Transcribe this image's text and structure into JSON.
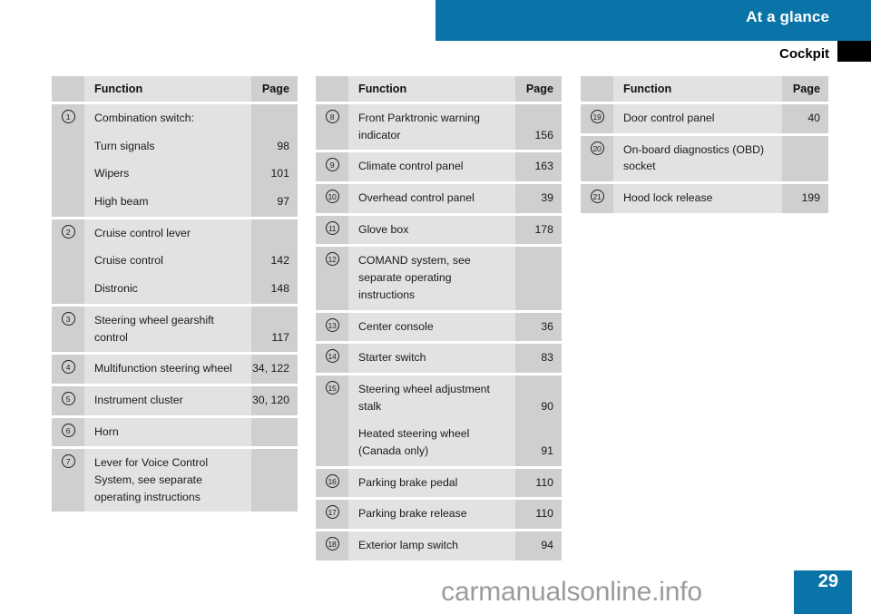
{
  "header": {
    "title": "At a glance",
    "section": "Cockpit"
  },
  "footer": {
    "watermark": "carmanualsonline.info",
    "page_number": "29"
  },
  "colors": {
    "accent_blue": "#0a74a8",
    "tab_black": "#000000",
    "cell_dark": "#cfcfcf",
    "cell_light": "#e2e2e2"
  },
  "columns": {
    "num": "",
    "function": "Function",
    "page": "Page"
  },
  "tables": [
    {
      "id": "table-1",
      "header": {
        "function": "Function",
        "page": "Page"
      },
      "rows": [
        {
          "num": "1",
          "lines": [
            {
              "function": "Combination switch:",
              "page": ""
            },
            {
              "function": "Turn signals",
              "page": "98"
            },
            {
              "function": "Wipers",
              "page": "101"
            },
            {
              "function": "High beam",
              "page": "97"
            }
          ]
        },
        {
          "num": "2",
          "lines": [
            {
              "function": "Cruise control lever",
              "page": ""
            },
            {
              "function": "Cruise control",
              "page": "142"
            },
            {
              "function": "Distronic",
              "page": "148"
            }
          ]
        },
        {
          "num": "3",
          "lines": [
            {
              "function": "Steering wheel gearshift control",
              "page": "117"
            }
          ]
        },
        {
          "num": "4",
          "lines": [
            {
              "function": "Multifunction steering wheel",
              "page": "34, 122"
            }
          ]
        },
        {
          "num": "5",
          "lines": [
            {
              "function": "Instrument cluster",
              "page": "30, 120"
            }
          ]
        },
        {
          "num": "6",
          "lines": [
            {
              "function": "Horn",
              "page": ""
            }
          ]
        },
        {
          "num": "7",
          "lines": [
            {
              "function": "Lever for Voice Control System, see separate operating instructions",
              "page": ""
            }
          ]
        }
      ]
    },
    {
      "id": "table-2",
      "header": {
        "function": "Function",
        "page": "Page"
      },
      "rows": [
        {
          "num": "8",
          "lines": [
            {
              "function": "Front Parktronic warning indicator",
              "page": "156"
            }
          ]
        },
        {
          "num": "9",
          "lines": [
            {
              "function": "Climate control panel",
              "page": "163"
            }
          ]
        },
        {
          "num": "10",
          "lines": [
            {
              "function": "Overhead control panel",
              "page": "39"
            }
          ]
        },
        {
          "num": "11",
          "lines": [
            {
              "function": "Glove box",
              "page": "178"
            }
          ]
        },
        {
          "num": "12",
          "lines": [
            {
              "function": "COMAND system, see separate operating instructions",
              "page": ""
            }
          ]
        },
        {
          "num": "13",
          "lines": [
            {
              "function": "Center console",
              "page": "36"
            }
          ]
        },
        {
          "num": "14",
          "lines": [
            {
              "function": "Starter switch",
              "page": "83"
            }
          ]
        },
        {
          "num": "15",
          "lines": [
            {
              "function": "Steering wheel adjustment stalk",
              "page": "90"
            },
            {
              "function": "Heated steering wheel (Canada only)",
              "page": "91"
            }
          ]
        },
        {
          "num": "16",
          "lines": [
            {
              "function": "Parking brake pedal",
              "page": "110"
            }
          ]
        },
        {
          "num": "17",
          "lines": [
            {
              "function": "Parking brake release",
              "page": "110"
            }
          ]
        },
        {
          "num": "18",
          "lines": [
            {
              "function": "Exterior lamp switch",
              "page": "94"
            }
          ]
        }
      ]
    },
    {
      "id": "table-3",
      "header": {
        "function": "Function",
        "page": "Page"
      },
      "rows": [
        {
          "num": "19",
          "lines": [
            {
              "function": "Door control panel",
              "page": "40"
            }
          ]
        },
        {
          "num": "20",
          "lines": [
            {
              "function": "On-board diagnostics (OBD) socket",
              "page": ""
            }
          ]
        },
        {
          "num": "21",
          "lines": [
            {
              "function": "Hood lock release",
              "page": "199"
            }
          ]
        }
      ]
    }
  ]
}
